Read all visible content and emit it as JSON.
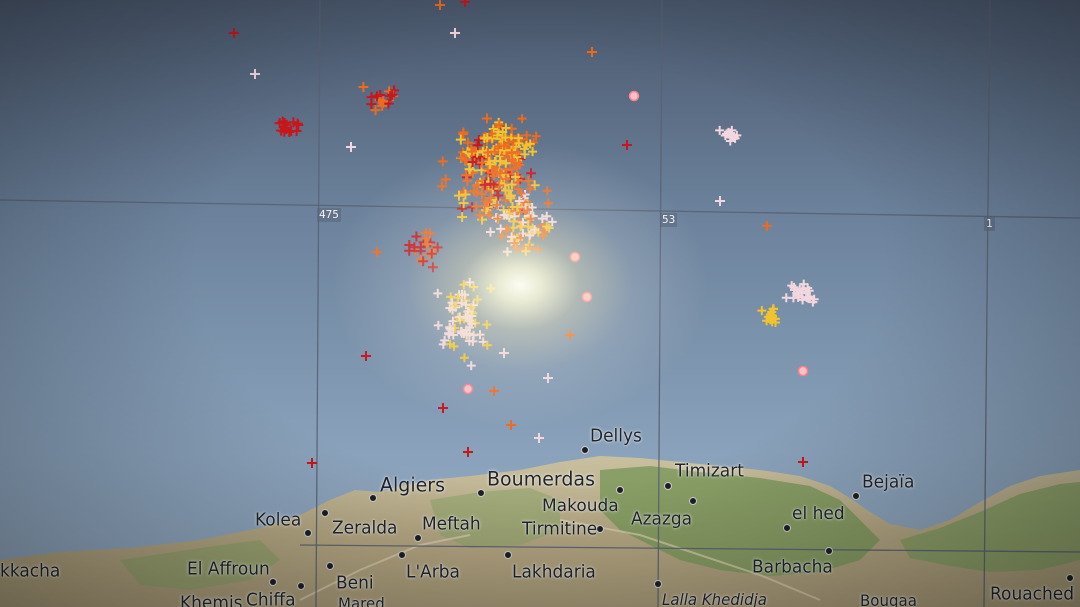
{
  "colors": {
    "sea_top": "#4d5c73",
    "sea_mid": "#7e97b2",
    "land": "#b8ad8a",
    "land_green": "#7d9a5c",
    "grid_line": "#5f6676",
    "strike_old": "#c8161c",
    "strike_mid": "#ee6a1e",
    "strike_recent": "#f1c32c",
    "strike_newest": "#f3d7df",
    "strike_circle": "#ff7f8a"
  },
  "grid_labels": [
    {
      "id": "grid-475",
      "text": "475"
    },
    {
      "id": "grid-53",
      "text": "53"
    },
    {
      "id": "grid-1",
      "text": "1"
    }
  ],
  "cities": [
    {
      "id": "dellys",
      "name": "Dellys"
    },
    {
      "id": "algiers",
      "name": "Algiers"
    },
    {
      "id": "boumerdas",
      "name": "Boumerdas"
    },
    {
      "id": "timizart",
      "name": "Timizart"
    },
    {
      "id": "bejaia",
      "name": "Bejaïa"
    },
    {
      "id": "kolea",
      "name": "Kolea"
    },
    {
      "id": "zeralda",
      "name": "Zeralda"
    },
    {
      "id": "meftah",
      "name": "Meftah"
    },
    {
      "id": "makouda",
      "name": "Makouda"
    },
    {
      "id": "tirmitine",
      "name": "Tirmitine"
    },
    {
      "id": "azazga",
      "name": "Azazga"
    },
    {
      "id": "el-hed",
      "name": "el hed"
    },
    {
      "id": "akkacha",
      "name": "kkacha"
    },
    {
      "id": "el-affroun",
      "name": "El Affroun"
    },
    {
      "id": "beni",
      "name": "Beni"
    },
    {
      "id": "larba",
      "name": "L'Arba"
    },
    {
      "id": "lakhdaria",
      "name": "Lakhdaria"
    },
    {
      "id": "barbacha",
      "name": "Barbacha"
    },
    {
      "id": "rouached",
      "name": "Rouached"
    },
    {
      "id": "khemis",
      "name": "Khemis"
    },
    {
      "id": "chiffa",
      "name": "Chiffa"
    },
    {
      "id": "lalla-khedidja",
      "name": "Lalla Khedidja"
    },
    {
      "id": "bougaa",
      "name": "Bougaa"
    },
    {
      "id": "mared",
      "name": "Mared"
    }
  ]
}
